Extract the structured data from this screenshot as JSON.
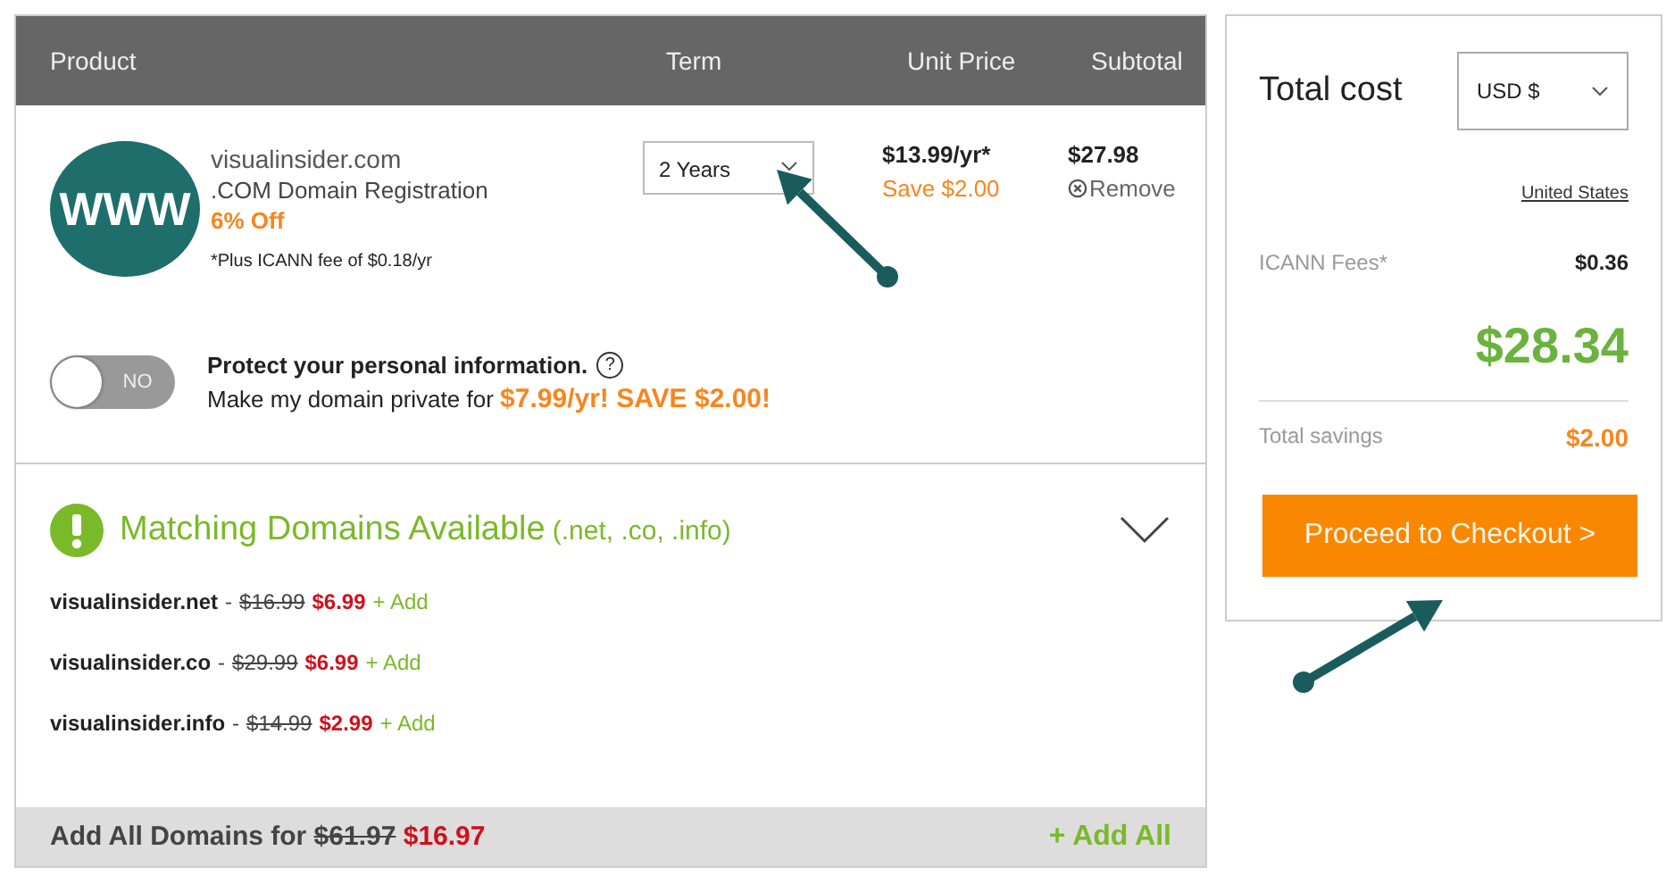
{
  "cart": {
    "columns": [
      "Product",
      "Term",
      "Unit Price",
      "Subtotal"
    ],
    "item": {
      "logo_text": "WWW",
      "domain": "visualinsider.com",
      "description": ".COM Domain Registration",
      "discount": "6% Off",
      "fee_note": "*Plus ICANN fee of $0.18/yr",
      "term": "2 Years",
      "unit_price": "$13.99/yr*",
      "unit_save": "Save $2.00",
      "subtotal": "$27.98",
      "remove": "Remove"
    },
    "privacy": {
      "on": false,
      "toggle_label": "NO",
      "title": "Protect your personal information.",
      "help": "?",
      "text": "Make my domain private for",
      "offer": "$7.99/yr! SAVE $2.00!"
    },
    "matching": {
      "title": "Matching Domains Available",
      "tlds": "(.net, .co, .info)",
      "expanded": true,
      "domains": [
        {
          "name": "visualinsider.net",
          "separator": "-",
          "old_price": "$16.99",
          "new_price": "$6.99",
          "add": "+ Add"
        },
        {
          "name": "visualinsider.co",
          "separator": "-",
          "old_price": "$29.99",
          "new_price": "$6.99",
          "add": "+ Add"
        },
        {
          "name": "visualinsider.info",
          "separator": "-",
          "old_price": "$14.99",
          "new_price": "$2.99",
          "add": "+ Add"
        }
      ],
      "add_all": {
        "label": "Add All Domains for",
        "old_price": "$61.97",
        "new_price": "$16.97",
        "button": "+ Add All"
      }
    }
  },
  "summary": {
    "title": "Total cost",
    "currency": "USD $",
    "country": "United States",
    "fees_label": "ICANN Fees*",
    "fees": "$0.36",
    "total": "$28.34",
    "savings_label": "Total savings",
    "savings": "$2.00",
    "checkout": "Proceed to Checkout >"
  }
}
